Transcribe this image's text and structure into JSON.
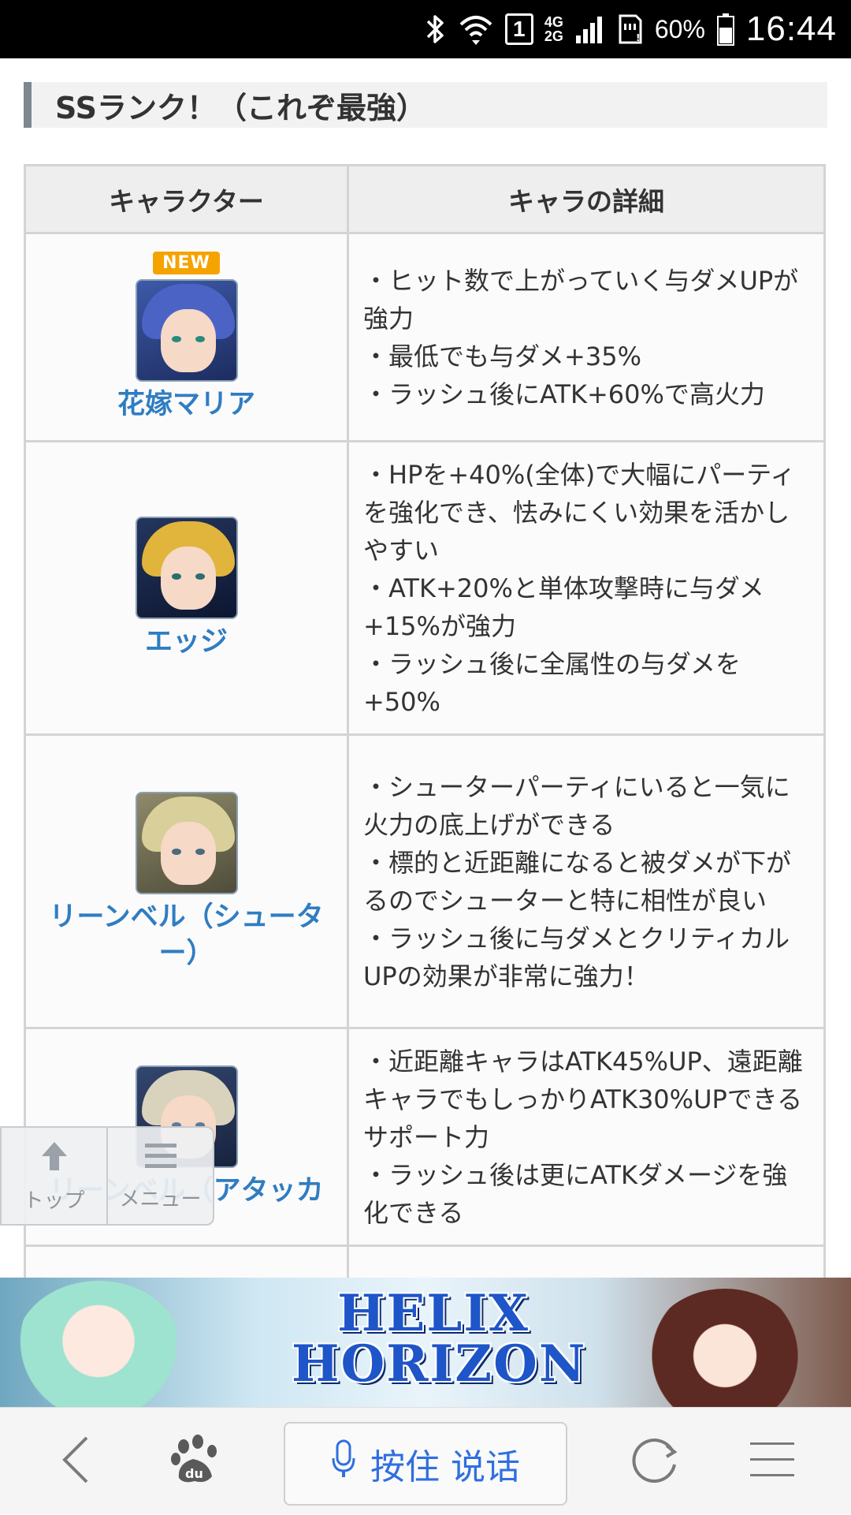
{
  "status_bar": {
    "sim_slot": "1",
    "network_top": "4G",
    "network_bottom": "2G",
    "battery": "60%",
    "time": "16:44",
    "icons": [
      "bluetooth-icon",
      "wifi-icon",
      "sim-icon",
      "signal-icon",
      "sd-card-icon",
      "battery-icon"
    ]
  },
  "section": {
    "title": "SSランク！（これぞ最強）"
  },
  "table": {
    "headers": [
      "キャラクター",
      "キャラの詳細"
    ],
    "rows": [
      {
        "badge": "NEW",
        "name": "花嫁マリア",
        "details": [
          "・ヒット数で上がっていく与ダメUPが強力",
          "・最低でも与ダメ+35%",
          "・ラッシュ後にATK+60%で高火力"
        ]
      },
      {
        "badge": "",
        "name": "エッジ",
        "details": [
          "・HPを+40%(全体)で大幅にパーティを強化でき、怯みにくい効果を活かしやすい",
          "・ATK+20%と単体攻撃時に与ダメ+15%が強力",
          "・ラッシュ後に全属性の与ダメを+50%"
        ]
      },
      {
        "badge": "",
        "name": "リーンベル（シューター）",
        "details": [
          "・シューターパーティにいると一気に火力の底上げができる",
          "・標的と近距離になると被ダメが下がるのでシューターと特に相性が良い",
          "・ラッシュ後に与ダメとクリティカルUPの効果が非常に強力！"
        ]
      },
      {
        "badge": "",
        "name": "リーンベル（アタッカ",
        "details": [
          "・近距離キャラはATK45%UP、遠距離キャラでもしっかりATK30%UPできるサポート力",
          "・ラッシュ後は更にATKダメージを強化できる"
        ]
      }
    ]
  },
  "float_nav": {
    "top_label": "トップ",
    "menu_label": "メニュー"
  },
  "banner": {
    "logo_line1": "HELIX",
    "logo_line2": "HORIZON"
  },
  "browser_bar": {
    "voice_label": "按住 说话",
    "icons": [
      "back-icon",
      "baidu-paw-icon",
      "microphone-icon",
      "refresh-icon",
      "menu-icon"
    ]
  }
}
